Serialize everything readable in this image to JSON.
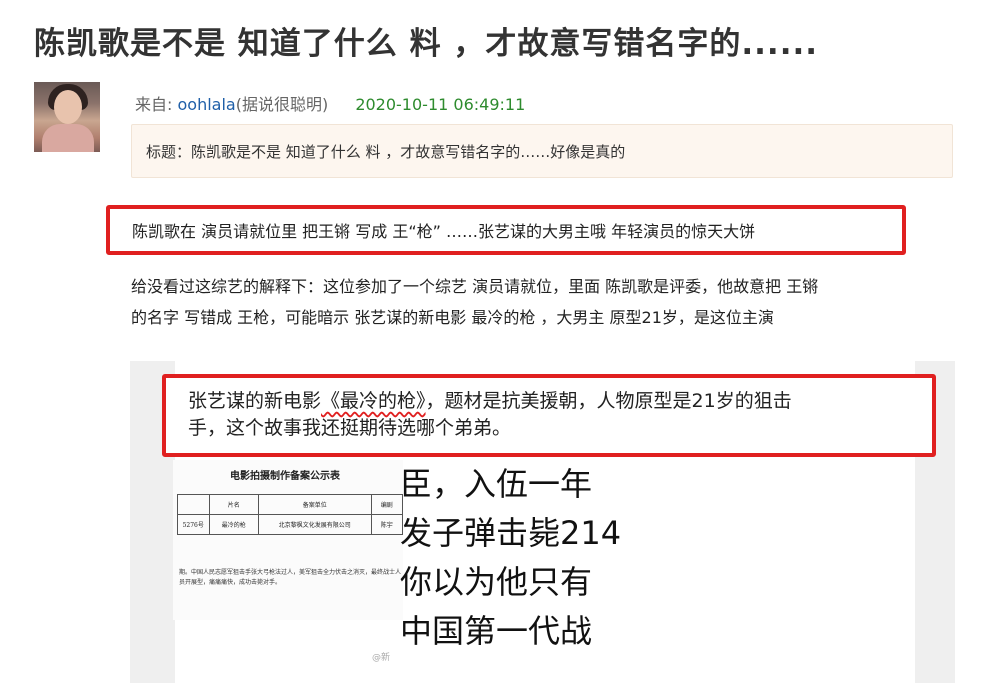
{
  "post": {
    "title": "陈凯歌是不是 知道了什么 料 ，才故意写错名字的......",
    "meta": {
      "from_label": "来自:",
      "username": "oohlala",
      "nickname": "(据说很聪明)",
      "timestamp": "2020-10-11 06:49:11"
    },
    "subject": "标题：陈凯歌是不是 知道了什么 料 ，才故意写错名字的……好像是真的",
    "highlight_line": "陈凯歌在 演员请就位里 把王锵 写成 王“枪” ……张艺谋的大男主哦 年轻演员的惊天大饼",
    "paragraph": {
      "line1": "给没看过这综艺的解释下：这位参加了一个综艺 演员请就位，里面 陈凯歌是评委，他故意把 王锵",
      "line2": "的名字 写错成 王枪，可能暗示 张艺谋的新电影 最冷的枪 ，大男主 原型21岁，是这位主演"
    }
  },
  "screenshot": {
    "highlight": {
      "prefix": "张艺谋的新电影",
      "film": "《最冷的枪》",
      "suffix": "，题材是抗美援朝，人物原型是21岁的狙击",
      "line2": "手，这个故事我还挺期待选哪个弟弟。"
    },
    "document": {
      "title": "电影拍摄制作备案公示表",
      "headers": [
        "",
        "片名",
        "备案单位",
        "编剧"
      ],
      "row": [
        "5276号",
        "最冷的枪",
        "北京黎枫文化发展有限公司",
        "陈宇"
      ],
      "note": "期。中国人民志愿军狙击手张大弓枪法过人，美军狙击全力伏击之消灭，最终战士人员开展型，痛痛痛快，成功击毙对手。"
    },
    "caption_lines": [
      "臣，入伍一年",
      "发子弹击毙214",
      "你以为他只有",
      "中国第一代战"
    ],
    "watermark": "@新"
  }
}
